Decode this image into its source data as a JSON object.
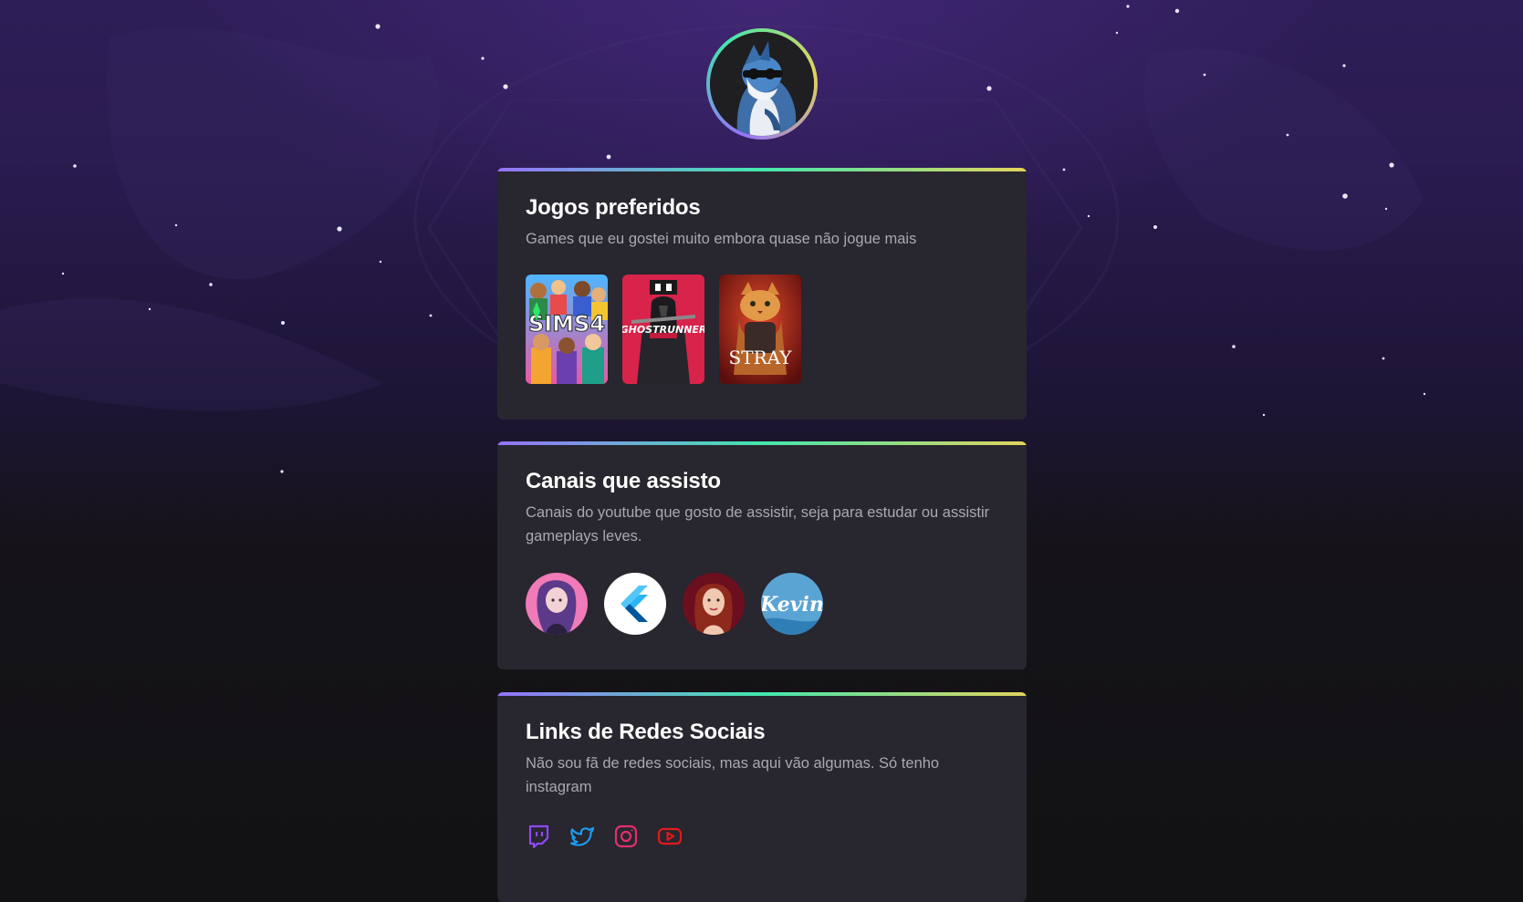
{
  "profile": {
    "avatar_icon": "blue-jay-avatar-icon",
    "ring_colors": [
      "#9572fc",
      "#43e7ad",
      "#e2d45c"
    ]
  },
  "sections": {
    "games": {
      "title": "Jogos preferidos",
      "description": "Games que eu gostei muito embora quase não jogue mais",
      "items": [
        {
          "icon": "sims4-cover-icon",
          "label": "SIMS4"
        },
        {
          "icon": "ghostrunner-cover-icon",
          "label": "GHOSTRUNNER"
        },
        {
          "icon": "stray-cover-icon",
          "label": "STRAY"
        }
      ]
    },
    "channels": {
      "title": "Canais que assisto",
      "description": "Canais do youtube que gosto de assistir, seja para estudar ou assistir gameplays leves.",
      "items": [
        {
          "icon": "channel-anime-girl-avatar-icon"
        },
        {
          "icon": "channel-flutter-logo-icon"
        },
        {
          "icon": "channel-redhead-avatar-icon"
        },
        {
          "icon": "channel-kevin-logo-icon",
          "label": "Kevin"
        }
      ]
    },
    "social": {
      "title": "Links de Redes Sociais",
      "description": "Não sou fã de redes sociais, mas aqui vão algumas. Só tenho instagram",
      "items": [
        {
          "icon": "twitch-icon",
          "color": "#9146ff"
        },
        {
          "icon": "twitter-icon",
          "color": "#1d9bf0"
        },
        {
          "icon": "instagram-icon",
          "color": "#e1306c"
        },
        {
          "icon": "youtube-icon",
          "color": "#e01a1a"
        }
      ]
    }
  },
  "colors": {
    "background_top": "#2e1e58",
    "background_bottom": "#121214",
    "card": "#28262e",
    "title": "#ffffff",
    "text": "#a9a9b2"
  }
}
